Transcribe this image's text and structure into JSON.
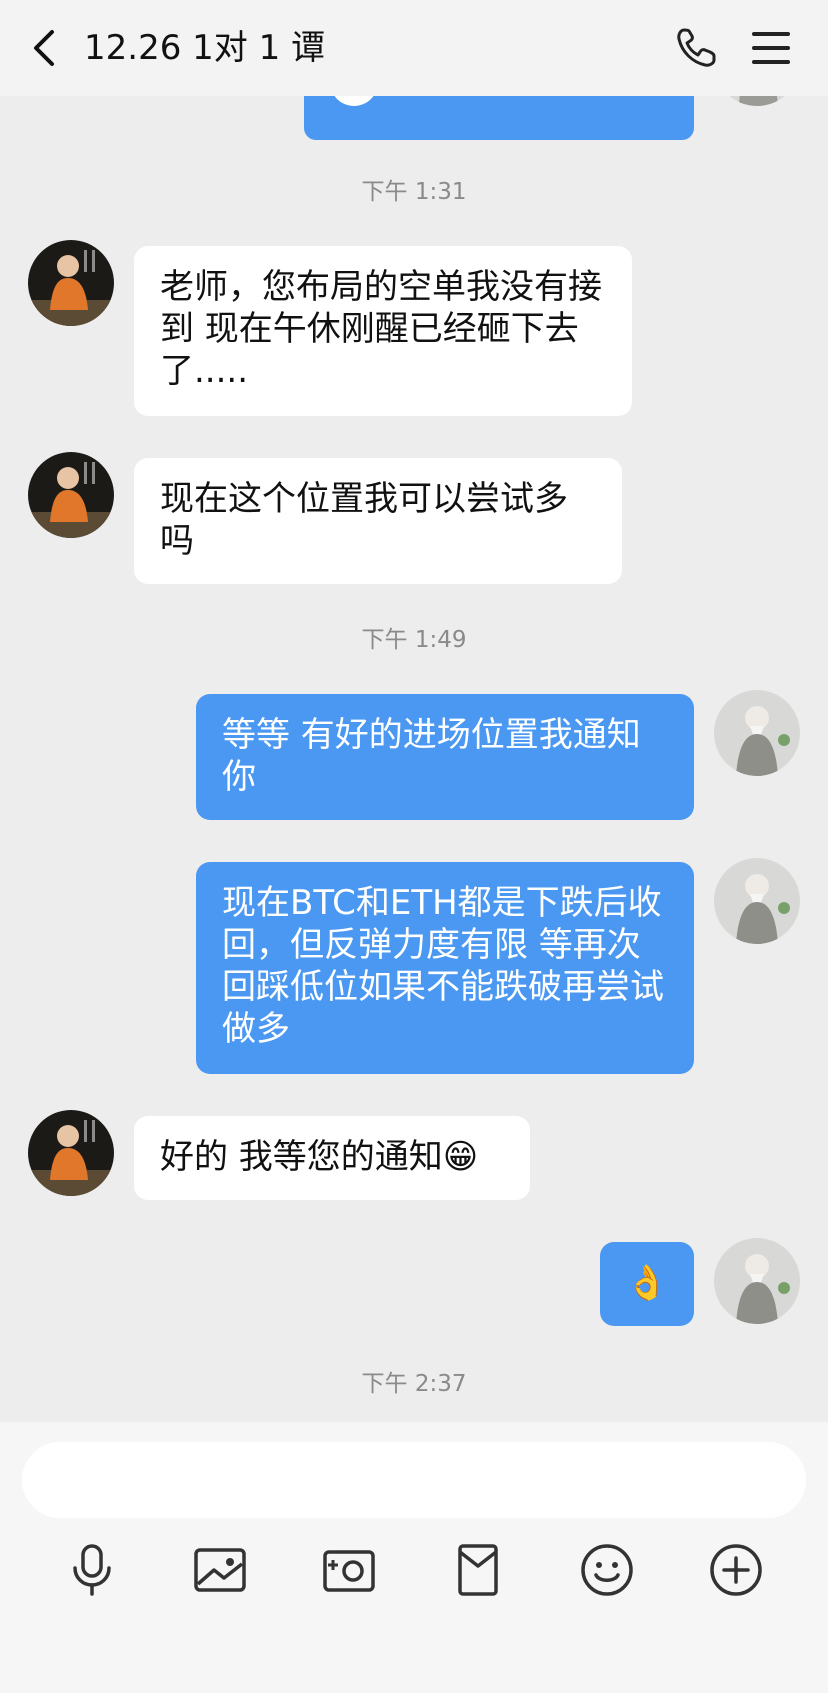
{
  "header": {
    "title": "12.26 1对 1 谭",
    "icons": [
      "chevron-left-icon",
      "phone-icon",
      "menu-icon"
    ]
  },
  "chat": {
    "time_1": "下午 1:31",
    "time_2": "下午 1:49",
    "time_3": "下午 2:37",
    "msg_1": "老师，您布局的空单我没有接到 现在午休刚醒已经砸下去了.....",
    "msg_2": "现在这个位置我可以尝试多吗",
    "msg_3": "等等 有好的进场位置我通知你",
    "msg_4": "现在BTC和ETH都是下跌后收回，但反弹力度有限 等再次回踩低位如果不能跌破再尝试做多",
    "msg_5": "好的 我等您的通知😁",
    "msg_6": "👌"
  },
  "composer": {
    "icons": [
      "microphone-icon",
      "image-icon",
      "camera-icon",
      "red-packet-icon",
      "emoji-icon",
      "plus-icon"
    ]
  },
  "colors": {
    "outgoing_bubble": "#4a98f2",
    "incoming_bubble": "#ffffff",
    "background": "#ededed"
  }
}
